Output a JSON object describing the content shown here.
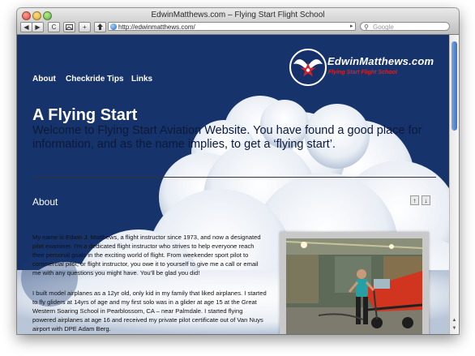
{
  "window": {
    "title": "EdwinMatthews.com – Flying Start Flight School"
  },
  "toolbar": {
    "back_label": "◀",
    "forward_label": "▶",
    "reload_label": "C",
    "addbookmark_label": "+",
    "url": "http://edwinmatthews.com/",
    "search_placeholder": "Google"
  },
  "nav": {
    "items": [
      {
        "label": "About"
      },
      {
        "label": "Checkride Tips"
      },
      {
        "label": "Links"
      }
    ]
  },
  "logo": {
    "name": "EdwinMatthews.com",
    "tagline": "Flying Start Flight School"
  },
  "hero": {
    "title": "A Flying Start",
    "subtitle": "Welcome to Flying Start Aviation Website. You have found a good place for information, and as the name implies, to get a ‘flying start’."
  },
  "section": {
    "title": "About",
    "up_label": "↑",
    "down_label": "↓",
    "paragraphs": [
      "My name is Edwin J. Matthews, a flight instructor since 1973, and now a designated pilot examiner. I’m a dedicated flight instructor who strives to help everyone reach their personal goals in the exciting world of flight. From weekender sport pilot to commercial pilot, or flight instructor, you owe it to yourself to give me a call or email me with any questions you might have. You’ll be glad you did!",
      "I built model airplanes as a 12yr old, only kid in my family that liked airplanes. I started to fly gliders at 14yrs of age and my first solo was in a glider at age 15 at the Great Western Soaring School in Pearblossom, CA – near Palmdale. I started flying powered airplanes at age 16 and received my private pilot certificate out of Van Nuys airport with DPE Adam Berg."
    ]
  },
  "colors": {
    "sky": "#17336b",
    "brand_red": "#d2232a",
    "scroll_thumb": "#3d73c2"
  },
  "icons": [
    "back-icon",
    "forward-icon",
    "reload-icon",
    "globe-icon",
    "search-icon",
    "star-logo-icon"
  ]
}
